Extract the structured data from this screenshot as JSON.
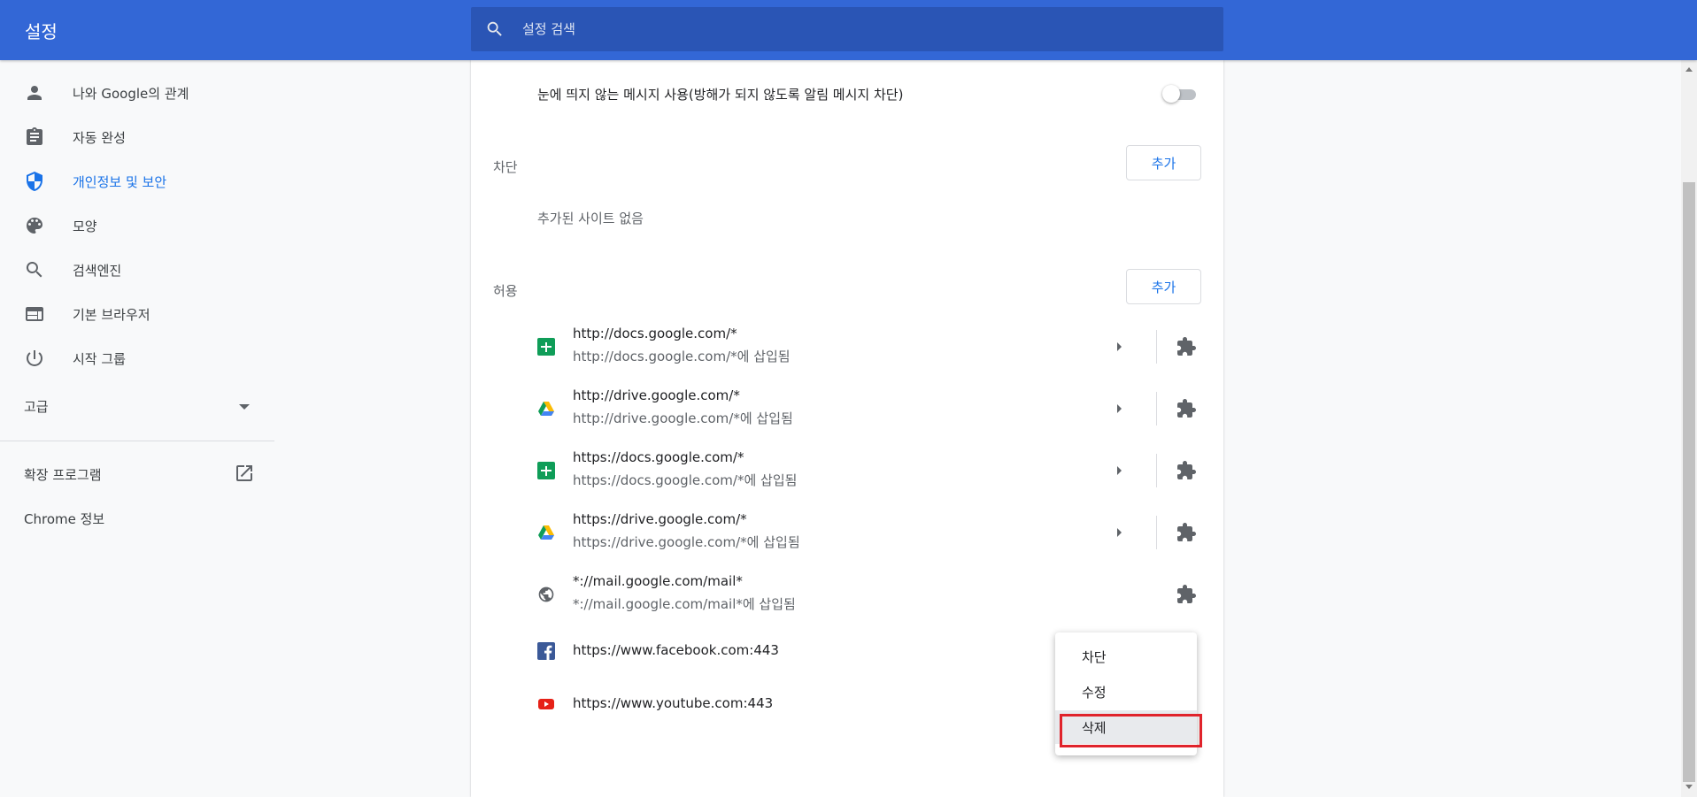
{
  "header": {
    "title": "설정",
    "search_placeholder": "설정 검색"
  },
  "sidebar": {
    "items": [
      {
        "label": "나와 Google의 관계",
        "icon": "person-icon",
        "active": false
      },
      {
        "label": "자동 완성",
        "icon": "clipboard-icon",
        "active": false
      },
      {
        "label": "개인정보 및 보안",
        "icon": "shield-icon",
        "active": true
      },
      {
        "label": "모양",
        "icon": "palette-icon",
        "active": false
      },
      {
        "label": "검색엔진",
        "icon": "search-icon",
        "active": false
      },
      {
        "label": "기본 브라우저",
        "icon": "browser-icon",
        "active": false
      },
      {
        "label": "시작 그룹",
        "icon": "power-icon",
        "active": false
      }
    ],
    "advanced_label": "고급",
    "extensions_label": "확장 프로그램",
    "about_label": "Chrome 정보"
  },
  "content": {
    "quiet_messaging_label": "눈에 띄지 않는 메시지 사용(방해가 되지 않도록 알림 메시지 차단)",
    "quiet_messaging_enabled": false,
    "block_section": {
      "label": "차단",
      "add_label": "추가",
      "empty_text": "추가된 사이트 없음"
    },
    "allow_section": {
      "label": "허용",
      "add_label": "추가",
      "sites": [
        {
          "url": "http://docs.google.com/*",
          "sub": "http://docs.google.com/*에 삽입됨",
          "favicon": "google-sheets-icon"
        },
        {
          "url": "http://drive.google.com/*",
          "sub": "http://drive.google.com/*에 삽입됨",
          "favicon": "google-drive-icon"
        },
        {
          "url": "https://docs.google.com/*",
          "sub": "https://docs.google.com/*에 삽입됨",
          "favicon": "google-sheets-icon"
        },
        {
          "url": "https://drive.google.com/*",
          "sub": "https://drive.google.com/*에 삽입됨",
          "favicon": "google-drive-icon"
        },
        {
          "url": "*://mail.google.com/mail*",
          "sub": "*://mail.google.com/mail*에 삽입됨",
          "favicon": "globe-icon"
        },
        {
          "url": "https://www.facebook.com:443",
          "favicon": "facebook-icon"
        },
        {
          "url": "https://www.youtube.com:443",
          "favicon": "youtube-icon"
        }
      ]
    }
  },
  "context_menu": {
    "items": [
      "차단",
      "수정",
      "삭제"
    ],
    "selected": "삭제"
  },
  "colors": {
    "header_bg": "#3367d6",
    "accent": "#1a73e8",
    "highlight": "#e0232b"
  }
}
